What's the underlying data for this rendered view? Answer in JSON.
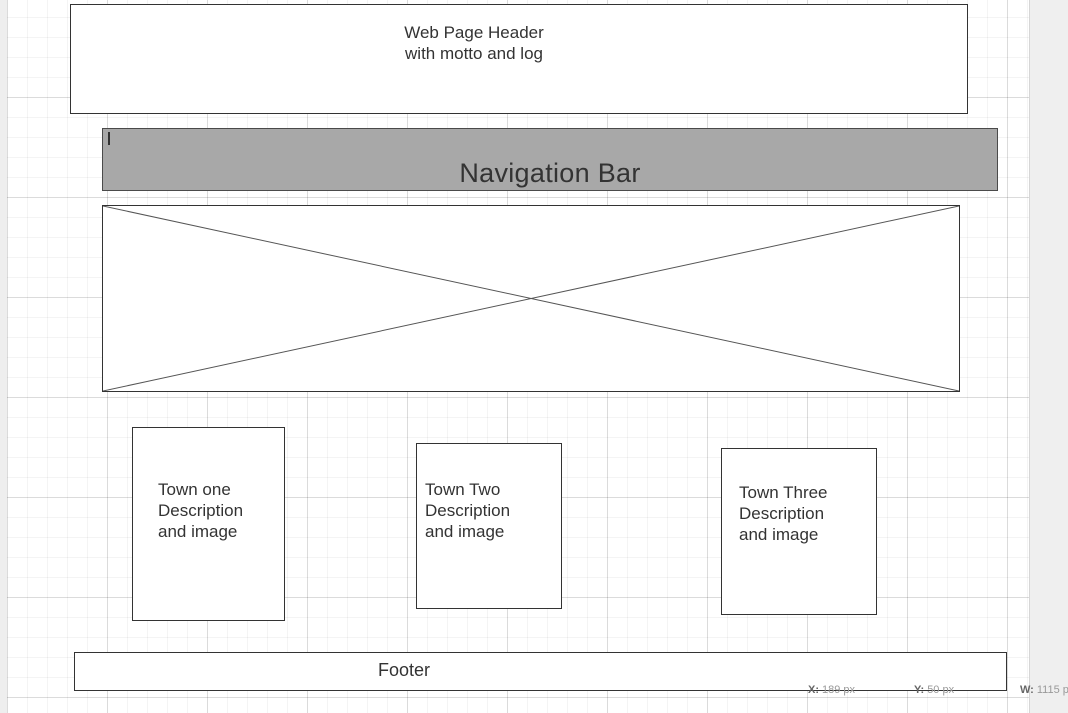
{
  "header": {
    "text": "Web Page Header\nwith motto and log"
  },
  "navigation": {
    "label": "Navigation Bar",
    "color": "#a8a8a8"
  },
  "image_placeholder": {
    "icon": "x-placeholder"
  },
  "towns": [
    {
      "text": "Town one\nDescription\nand image"
    },
    {
      "text": "Town Two\nDescription\nand image"
    },
    {
      "text": "Town Three\nDescription\nand image"
    }
  ],
  "footer": {
    "label": "Footer"
  },
  "status": {
    "x_label": "X:",
    "x_value": "189 px",
    "y_label": "Y:",
    "y_value": "50 px",
    "w_label": "W:",
    "w_value": "1115 p"
  }
}
